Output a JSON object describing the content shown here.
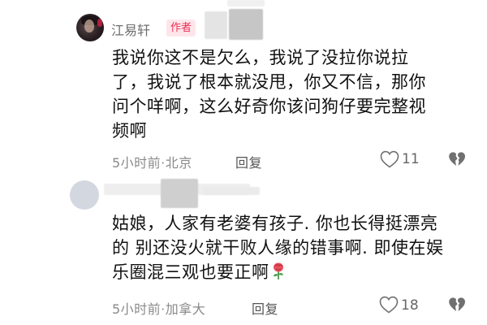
{
  "comments": [
    {
      "username": "江易轩",
      "badge": "作者",
      "text": "我说你这不是欠么，我说了没拉你说拉\n了，我说了根本就没甩，你又不信，那你\n问个咩啊，这么好奇你该问狗仔要完整视\n频啊",
      "meta": "5小时前·北京",
      "reply_label": "回复",
      "like_count": "11",
      "icons": {
        "like": "heart-outline-icon",
        "dislike": "broken-heart-icon"
      }
    },
    {
      "username": "",
      "text": "姑娘，人家有老婆有孩子. 你也长得挺漂亮\n的 别还没火就干败人缘的错事啊. 即使在娱\n乐圈混三观也要正啊",
      "emoji": "rose-emoji",
      "meta": "5小时前·加拿大",
      "reply_label": "回复",
      "like_count": "18",
      "icons": {
        "like": "heart-outline-icon",
        "dislike": "broken-heart-icon"
      }
    }
  ],
  "colors": {
    "badge_bg": "#fde6ea",
    "badge_text": "#ef2d55",
    "meta_text": "#8a8a8a",
    "body_text": "#111111"
  }
}
